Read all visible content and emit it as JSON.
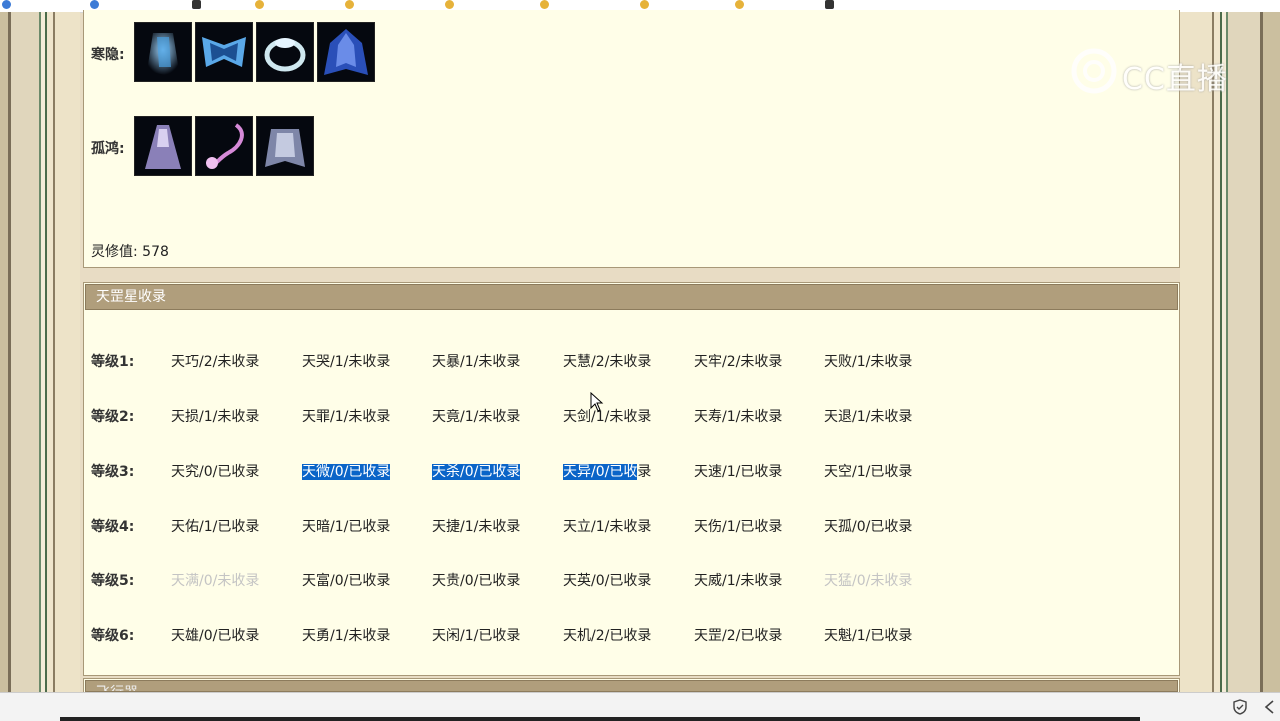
{
  "logo_text": "CC直播",
  "gear_section": {
    "rows": [
      {
        "label": "寒隐:",
        "items": [
          "robe-icon",
          "armor-icon",
          "ring-icon",
          "cloak-icon"
        ]
      },
      {
        "label": "孤鸿:",
        "items": [
          "dress-icon",
          "bracelet-icon",
          "robe-icon"
        ]
      }
    ],
    "lingxiu_label": "灵修值:",
    "lingxiu_value": "578"
  },
  "stars_section": {
    "title": "天罡星收录",
    "levels": [
      {
        "label": "等级1:",
        "cells": [
          "天巧/2/未收录",
          "天哭/1/未收录",
          "天暴/1/未收录",
          "天慧/2/未收录",
          "天牢/2/未收录",
          "天败/1/未收录"
        ]
      },
      {
        "label": "等级2:",
        "cells": [
          "天损/1/未收录",
          "天罪/1/未收录",
          "天竟/1/未收录",
          "天剑/1/未收录",
          "天寿/1/未收录",
          "天退/1/未收录"
        ]
      },
      {
        "label": "等级3:",
        "cells": [
          "天究/0/已收录",
          "天微/0/已收录",
          "天杀/0/已收录",
          "天异/0/已收录",
          "天速/1/已收录",
          "天空/1/已收录"
        ]
      },
      {
        "label": "等级4:",
        "cells": [
          "天佑/1/已收录",
          "天暗/1/已收录",
          "天捷/1/未收录",
          "天立/1/未收录",
          "天伤/1/已收录",
          "天孤/0/已收录"
        ]
      },
      {
        "label": "等级5:",
        "cells": [
          "天满/0/未收录",
          "天富/0/已收录",
          "天贵/0/已收录",
          "天英/0/已收录",
          "天威/1/未收录",
          "天猛/0/未收录"
        ]
      },
      {
        "label": "等级6:",
        "cells": [
          "天雄/0/已收录",
          "天勇/1/未收录",
          "天闲/1/已收录",
          "天机/2/已收录",
          "天罡/2/已收录",
          "天魁/1/已收录"
        ]
      }
    ]
  },
  "next_section": {
    "title": "飞行器"
  },
  "colors": {
    "panel_bg": "#fffee8",
    "header_bg": "#b09e7c",
    "selection": "#0a64c8",
    "faded_text": "#c4c4c4"
  }
}
